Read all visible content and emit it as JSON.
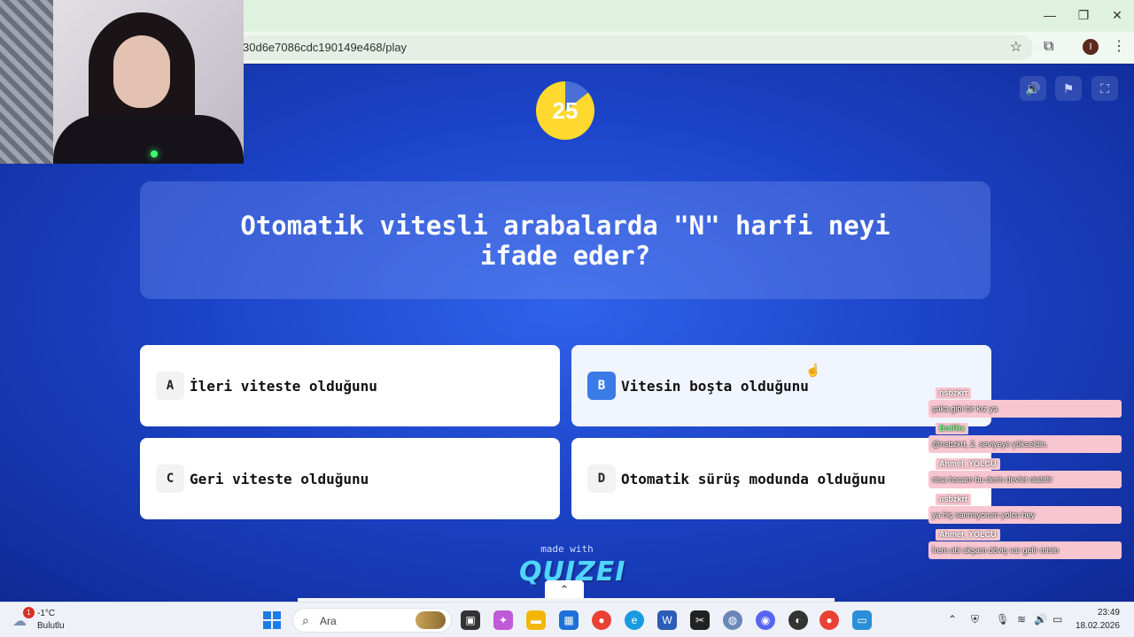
{
  "browser": {
    "url": "30d6e7086cdc190149e468/play",
    "window_controls": [
      "—",
      "❐",
      "✕"
    ],
    "profile_initial": "I"
  },
  "quiz": {
    "timer": "25",
    "question": "Otomatik vitesli arabalarda \"N\" harfi neyi ifade eder?",
    "answers": [
      {
        "letter": "A",
        "text": "İleri viteste olduğunu"
      },
      {
        "letter": "B",
        "text": "Vitesin boşta olduğunu"
      },
      {
        "letter": "C",
        "text": "Geri viteste olduğunu"
      },
      {
        "letter": "D",
        "text": "Otomatik sürüş modunda olduğunu"
      }
    ],
    "made_with": "made with",
    "brand": "QUIZEI"
  },
  "chat": [
    {
      "user": "nsbzkrt",
      "message": "şaka gibi bir kız ya"
    },
    {
      "user": "BotRix",
      "message": "@nsbzkrt, 2. seviyeye yükseldin."
    },
    {
      "user": "Ahmet_YOLCU",
      "message": "nisa hocam bu derin devlet olabilir"
    },
    {
      "user": "nsbzkrt",
      "message": "ya hiç sanmıyorum yolcu bey"
    },
    {
      "user": "Ahmet_YOLCU",
      "message": "İrem abi akşam döviş var gelir misin"
    }
  ],
  "taskbar": {
    "weather_badge": "1",
    "temperature": "-1°C",
    "weather_desc": "Bulutlu",
    "search_placeholder": "Ara",
    "time": "23:49",
    "date": "18.02.2026"
  }
}
